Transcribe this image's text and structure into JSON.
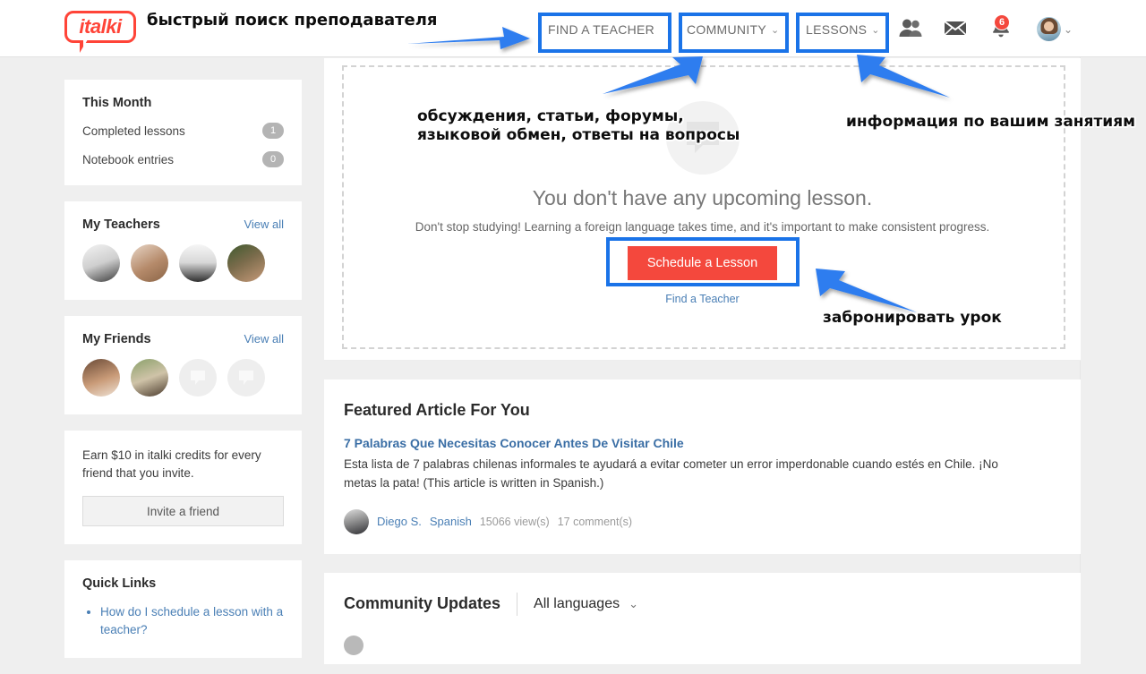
{
  "header": {
    "logo_text": "italki",
    "nav": [
      {
        "label": "FIND A TEACHER",
        "has_caret": false
      },
      {
        "label": "COMMUNITY",
        "has_caret": true,
        "caret": "⌄"
      },
      {
        "label": "LESSONS",
        "has_caret": true,
        "caret": "⌄"
      }
    ],
    "icons": {
      "people": "people-icon",
      "mail": "mail-icon",
      "bell": "bell-icon",
      "avatar": "user-avatar"
    },
    "notification_count": "6",
    "avatar_caret": "⌄"
  },
  "sidebar": {
    "this_month": {
      "title": "This Month",
      "rows": [
        {
          "label": "Completed lessons",
          "value": "1"
        },
        {
          "label": "Notebook entries",
          "value": "0"
        }
      ]
    },
    "my_teachers": {
      "title": "My Teachers",
      "view_all": "View all",
      "count": 4
    },
    "my_friends": {
      "title": "My Friends",
      "view_all": "View all",
      "count": 4
    },
    "referral": {
      "text": "Earn $10 in italki credits for every friend that you invite.",
      "button": "Invite a friend"
    },
    "quick_links": {
      "title": "Quick Links",
      "items": [
        "How do I schedule a lesson with a teacher?"
      ]
    }
  },
  "main": {
    "upcoming": {
      "title": "You don't have any upcoming lesson.",
      "subtitle": "Don't stop studying! Learning a foreign language takes time, and it's important to make consistent progress.",
      "primary_button": "Schedule a Lesson",
      "secondary_link": "Find a Teacher"
    },
    "featured_article": {
      "section_title": "Featured Article For You",
      "title": "7 Palabras Que Necesitas Conocer Antes De Visitar Chile",
      "body": "Esta lista de 7 palabras chilenas informales te ayudará a evitar cometer un error imperdonable cuando estés en Chile. ¡No metas la pata! (This article is written in Spanish.)",
      "author": "Diego S.",
      "language": "Spanish",
      "views": "15066 view(s)",
      "comments": "17 comment(s)"
    },
    "community_updates": {
      "section_title": "Community Updates",
      "filter_label": "All languages",
      "filter_caret": "⌄"
    }
  },
  "annotations": {
    "texts": [
      {
        "id": "find-teacher-note",
        "text": "быстрый поиск преподавателя"
      },
      {
        "id": "community-note",
        "text": "обсуждения, статьи, форумы,\nязыковой обмен, ответы на вопросы"
      },
      {
        "id": "lessons-note",
        "text": "информация по вашим занятиям"
      },
      {
        "id": "schedule-note",
        "text": "забронировать урок"
      }
    ],
    "highlight_color": "#1a73e8",
    "arrow_color": "#2f7def"
  },
  "colors": {
    "brand_red": "#ff4438",
    "link_blue": "#4a7fb5",
    "cta_red": "#f4483d",
    "page_bg": "#efefef"
  }
}
